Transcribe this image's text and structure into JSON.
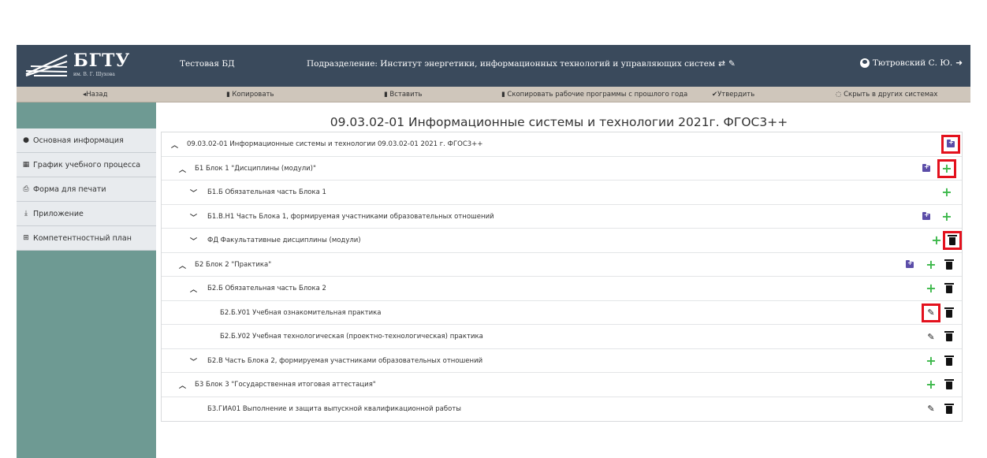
{
  "header": {
    "logo_name": "БГТУ",
    "logo_sub": "им. В. Г. Шухова",
    "db_name": "Тестовая БД",
    "division": "Подразделение: Институт энергетики, информационных технологий и управляющих систем",
    "user": "Тютровский С. Ю."
  },
  "toolbar": {
    "back": "◂Назад",
    "copy": "Копировать",
    "paste": "Вставить",
    "copy_programs": "Скопировать рабочие программы с прошлого года",
    "approve": "Утвердить",
    "hide": "Скрыть в других системах"
  },
  "sidebar": {
    "items": [
      {
        "label": "Основная информация",
        "icon": "info-circle-icon"
      },
      {
        "label": "График учебного процесса",
        "icon": "calendar-icon"
      },
      {
        "label": "Форма для печати",
        "icon": "printer-icon"
      },
      {
        "label": "Приложение",
        "icon": "download-icon"
      },
      {
        "label": "Компетентностный план",
        "icon": "table-icon"
      }
    ]
  },
  "page": {
    "title": "09.03.02-01 Информационные системы и технологии 2021г. ФГОС3++"
  },
  "tree": {
    "rows": [
      {
        "label": "09.03.02-01 Информационные системы и технологии 09.03.02-01 2021 г. ФГОС3++",
        "chevron": "up"
      },
      {
        "label": "Б1 Блок 1 \"Дисциплины (модули)\"",
        "chevron": "up"
      },
      {
        "label": "Б1.Б Обязательная часть Блока 1",
        "chevron": "down"
      },
      {
        "label": "Б1.В.Н1 Часть Блока 1, формируемая участниками образовательных отношений",
        "chevron": "down"
      },
      {
        "label": "ФД Факультативные дисциплины (модули)",
        "chevron": "down"
      },
      {
        "label": "Б2 Блок 2 \"Практика\"",
        "chevron": "up"
      },
      {
        "label": "Б2.Б Обязательная часть Блока 2",
        "chevron": "up"
      },
      {
        "label": "Б2.Б.У01 Учебная ознакомительная практика",
        "chevron": ""
      },
      {
        "label": "Б2.Б.У02 Учебная технологическая (проектно-технологическая) практика",
        "chevron": ""
      },
      {
        "label": "Б2.В Часть Блока 2, формируемая участниками образовательных отношений",
        "chevron": "down"
      },
      {
        "label": "Б3 Блок 3 \"Государственная итоговая аттестация\"",
        "chevron": "up"
      },
      {
        "label": "Б3.ГИА01 Выполнение и защита выпускной квалификационной работы",
        "chevron": ""
      }
    ]
  },
  "colors": {
    "header_bg": "#3a4a5c",
    "toolbar_bg": "#cfc6bb",
    "sidebar_bg": "#6e9a93",
    "add_green": "#3cb84a",
    "folder_purple": "#5b4da8",
    "highlight_red": "#e3111d"
  }
}
